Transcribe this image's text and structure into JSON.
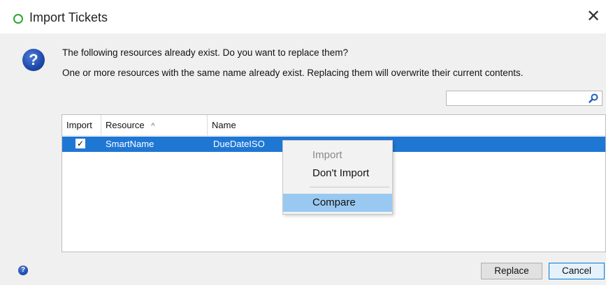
{
  "window": {
    "title": "Import Tickets",
    "close_glyph": "✕"
  },
  "message": {
    "icon_glyph": "?",
    "line1": "The following resources already exist. Do you want to replace them?",
    "line2": "One or more resources with the same name already exist. Replacing them will overwrite their current contents."
  },
  "search": {
    "value": "",
    "placeholder": ""
  },
  "table": {
    "columns": [
      "Import",
      "Resource",
      "Name"
    ],
    "sort_caret": "^",
    "rows": [
      {
        "import": true,
        "check_glyph": "✓",
        "resource": "SmartName",
        "name": "DueDateISO"
      }
    ]
  },
  "context_menu": {
    "items": [
      {
        "label": "Import",
        "state": "disabled"
      },
      {
        "label": "Don't Import",
        "state": "normal"
      },
      {
        "label": "Compare",
        "state": "highlighted"
      }
    ]
  },
  "footer": {
    "help_glyph": "?",
    "replace_label": "Replace",
    "cancel_label": "Cancel"
  },
  "colors": {
    "selection": "#1f77d4",
    "menu_highlight": "#99c9f1",
    "app_icon": "#2fa52f",
    "question_icon": "#1d4aa8"
  }
}
